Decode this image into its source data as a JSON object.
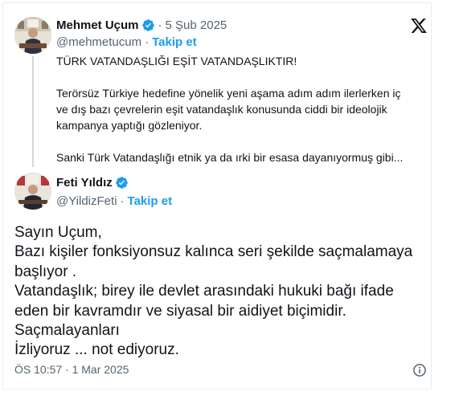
{
  "quoted_tweet": {
    "author_name": "Mehmet Uçum",
    "separator": "·",
    "date": "5 Şub 2025",
    "handle": "@mehmetucum",
    "handle_separator": "·",
    "follow_label": "Takip et",
    "lines": [
      "TÜRK VATANDAŞLIĞI EŞİT VATANDAŞLIKTIR!",
      "",
      "Terörsüz Türkiye hedefine yönelik yeni aşama adım adım ilerlerken iç",
      "ve dış bazı çevrelerin eşit vatandaşlık konusunda ciddi bir ideolojik",
      "kampanya yaptığı gözleniyor.",
      "",
      "Sanki Türk Vatandaşlığı etnik ya da ırki bir esasa dayanıyormuş gibi..."
    ]
  },
  "reply_tweet": {
    "author_name": "Feti Yıldız",
    "handle": "@YildizFeti",
    "handle_separator": "·",
    "follow_label": "Takip et",
    "lines": [
      "Sayın Uçum,",
      "Bazı kişiler fonksiyonsuz kalınca seri şekilde saçmalamaya",
      "başlıyor .",
      "Vatandaşlık; birey ile devlet arasındaki hukuki bağı ifade",
      "eden bir kavramdır ve siyasal bir aidiyet biçimidir.",
      "Saçmalayanları",
      "İzliyoruz ... not ediyoruz."
    ],
    "timestamp": "ÖS 10:57 · 1 Mar 2025"
  },
  "icons": {
    "platform": "x-logo-icon",
    "verified": "verified-badge-icon",
    "info": "info-icon"
  },
  "colors": {
    "accent": "#1d9bf0",
    "secondary_text": "#536471",
    "primary_text": "#0f1419",
    "thread_line": "#cfd9de"
  }
}
